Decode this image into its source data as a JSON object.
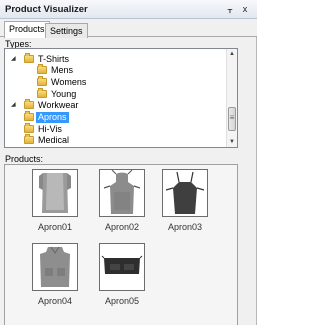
{
  "window": {
    "title": "Product Visualizer",
    "pin_glyph": "ᚁ",
    "close_glyph": "x"
  },
  "tabs": [
    {
      "label": "Products",
      "active": true
    },
    {
      "label": "Settings",
      "active": false
    }
  ],
  "types_label": "Types:",
  "tree": {
    "nodes": [
      {
        "label": "T-Shirts",
        "level": 0,
        "expanded": true,
        "selected": false
      },
      {
        "label": "Mens",
        "level": 1,
        "selected": false
      },
      {
        "label": "Womens",
        "level": 1,
        "selected": false
      },
      {
        "label": "Young",
        "level": 1,
        "selected": false
      },
      {
        "label": "Workwear",
        "level": 0,
        "expanded": true,
        "selected": false
      },
      {
        "label": "Aprons",
        "level": 1,
        "selected": true
      },
      {
        "label": "Hi-Vis",
        "level": 1,
        "selected": false
      },
      {
        "label": "Medical",
        "level": 1,
        "selected": false
      }
    ],
    "selection_color": "#3399ff"
  },
  "products_label": "Products:",
  "products": [
    {
      "name": "Apron01"
    },
    {
      "name": "Apron02"
    },
    {
      "name": "Apron03"
    },
    {
      "name": "Apron04"
    },
    {
      "name": "Apron05"
    }
  ]
}
